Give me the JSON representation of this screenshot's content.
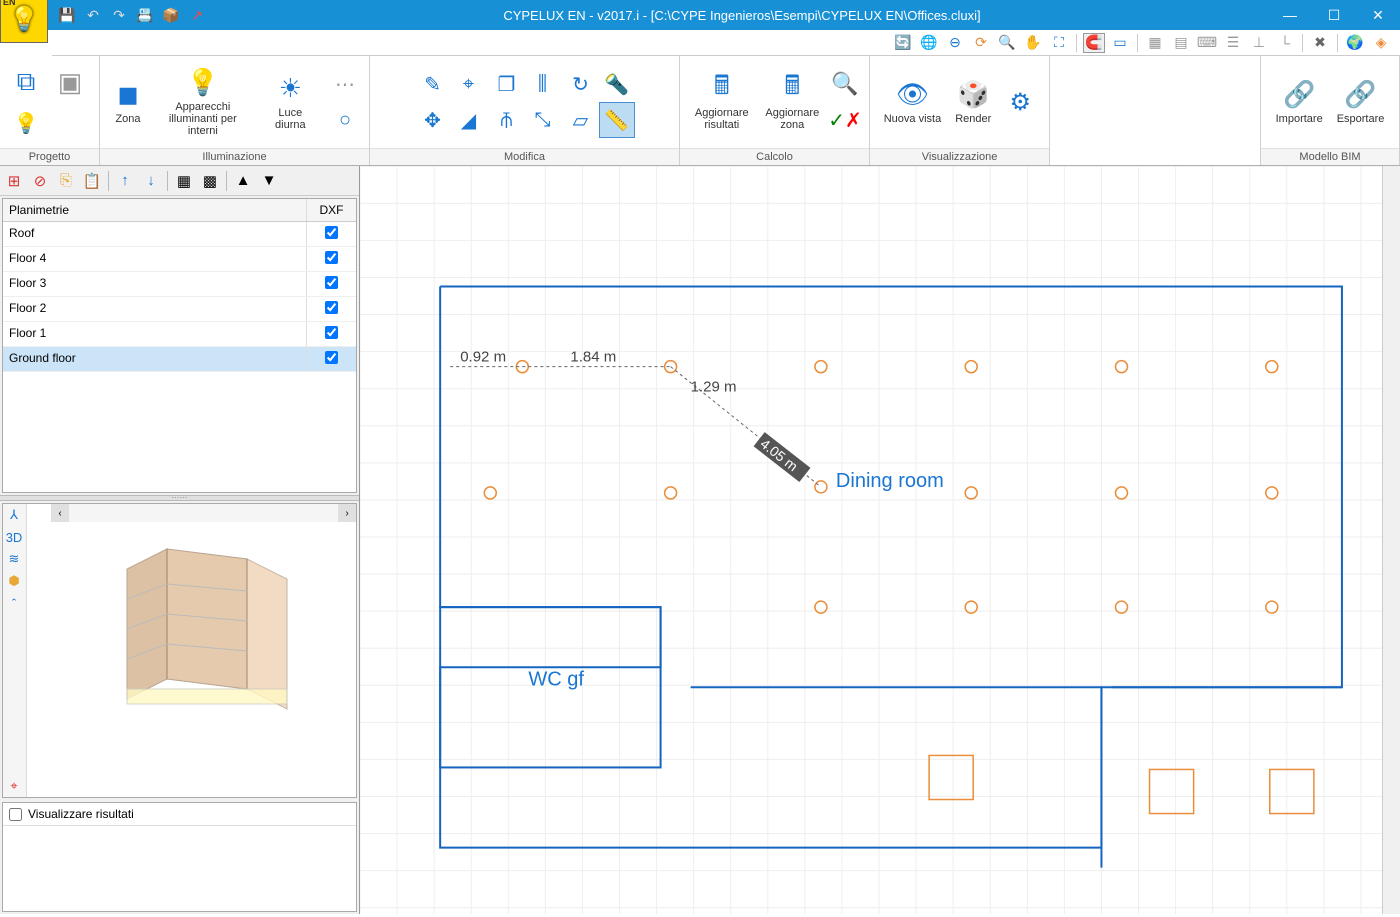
{
  "title": "CYPELUX EN - v2017.i - [C:\\CYPE Ingenieros\\Esempi\\CYPELUX EN\\Offices.cluxi]",
  "logo": "EN",
  "qat": {
    "save": "💾",
    "undo": "↶",
    "redo": "↷",
    "print": "⎙",
    "box": "📦",
    "export": "↗"
  },
  "ribbon": {
    "groups": {
      "progetto": "Progetto",
      "illuminazione": "Illuminazione",
      "modifica": "Modifica",
      "calcolo": "Calcolo",
      "visualizzazione": "Visualizzazione",
      "modello": "Modello BIM"
    },
    "zona": "Zona",
    "apparecchi": "Apparecchi illuminanti per interni",
    "luce_diurna": "Luce diurna",
    "aggiornare_risultati": "Aggiornare risultati",
    "aggiornare_zona": "Aggiornare zona",
    "nuova_vista": "Nuova vista",
    "render": "Render",
    "importare": "Importare",
    "esportare": "Esportare"
  },
  "floors": {
    "header_name": "Planimetrie",
    "header_dxf": "DXF",
    "rows": [
      {
        "name": "Roof",
        "dxf": true
      },
      {
        "name": "Floor 4",
        "dxf": true
      },
      {
        "name": "Floor 3",
        "dxf": true
      },
      {
        "name": "Floor 2",
        "dxf": true
      },
      {
        "name": "Floor 1",
        "dxf": true
      },
      {
        "name": "Ground floor",
        "dxf": true,
        "selected": true
      }
    ]
  },
  "results": {
    "checkbox_label": "Visualizzare risultati"
  },
  "canvas": {
    "dim1": "0.92 m",
    "dim2": "1.84 m",
    "dim3": "1.29 m",
    "dim4": "4.05 m",
    "room1": "Dining room",
    "room2": "WC gf"
  }
}
